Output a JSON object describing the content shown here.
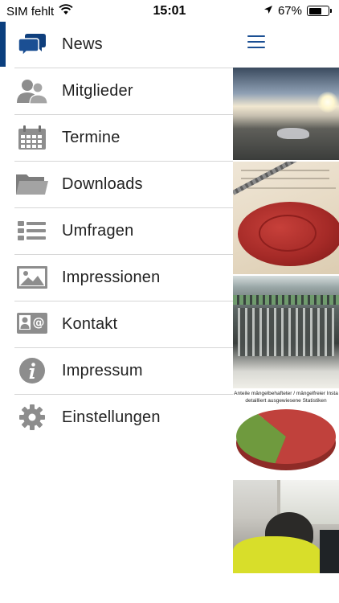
{
  "status_bar": {
    "carrier": "SIM fehlt",
    "time": "15:01",
    "battery_percent": "67%",
    "battery_level": 0.67
  },
  "menu": {
    "active_index": 0,
    "accent_color": "#0b3f7e",
    "items": [
      {
        "label": "News",
        "icon": "chat-bubbles-icon"
      },
      {
        "label": "Mitglieder",
        "icon": "members-icon"
      },
      {
        "label": "Termine",
        "icon": "calendar-icon"
      },
      {
        "label": "Downloads",
        "icon": "folder-icon"
      },
      {
        "label": "Umfragen",
        "icon": "list-icon"
      },
      {
        "label": "Impressionen",
        "icon": "image-icon"
      },
      {
        "label": "Kontakt",
        "icon": "contact-card-icon"
      },
      {
        "label": "Impressum",
        "icon": "info-icon"
      },
      {
        "label": "Einstellungen",
        "icon": "gear-icon"
      }
    ]
  },
  "feed_thumbnails": {
    "chart_caption_line1": "Anteile  mängelbehafteter / mängelfreier Insta",
    "chart_caption_line2": "detailliert ausgewiesene Statistiken",
    "chart_data": {
      "type": "pie",
      "values": [
        63,
        37
      ],
      "colors": [
        "#c0413c",
        "#6f9a3e"
      ],
      "labels": [
        "",
        ""
      ]
    }
  }
}
